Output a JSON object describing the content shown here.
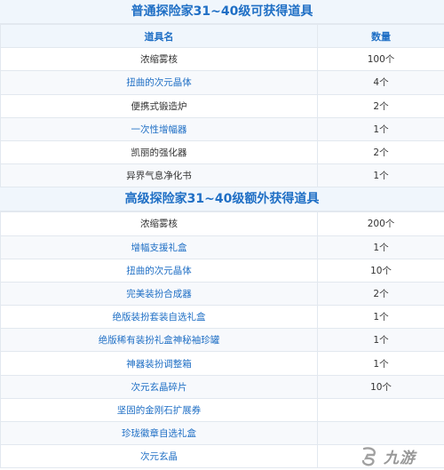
{
  "section1": {
    "title": "普通探险家31~40级可获得道具",
    "header": {
      "item": "道具名",
      "qty": "数量"
    },
    "rows": [
      {
        "name": "浓缩雾核",
        "qty": "100个",
        "link": false
      },
      {
        "name": "扭曲的次元晶体",
        "qty": "4个",
        "link": true
      },
      {
        "name": "便携式锻造炉",
        "qty": "2个",
        "link": false
      },
      {
        "name": "一次性增幅器",
        "qty": "1个",
        "link": true
      },
      {
        "name": "凯丽的强化器",
        "qty": "2个",
        "link": false
      },
      {
        "name": "异界气息净化书",
        "qty": "1个",
        "link": false
      }
    ]
  },
  "section2": {
    "title": "高级探险家31~40级额外获得道具",
    "rows": [
      {
        "name": "浓缩雾核",
        "qty": "200个",
        "link": false
      },
      {
        "name": "增幅支援礼盒",
        "qty": "1个",
        "link": true
      },
      {
        "name": "扭曲的次元晶体",
        "qty": "10个",
        "link": true
      },
      {
        "name": "完美装扮合成器",
        "qty": "2个",
        "link": true
      },
      {
        "name": "绝版装扮套装自选礼盒",
        "qty": "1个",
        "link": true
      },
      {
        "name": "绝版稀有装扮礼盒神秘袖珍罐",
        "qty": "1个",
        "link": true
      },
      {
        "name": "神器装扮调整箱",
        "qty": "1个",
        "link": true
      },
      {
        "name": "次元玄晶碎片",
        "qty": "10个",
        "link": true
      },
      {
        "name": "坚固的金刚石扩展券",
        "qty": "",
        "link": true
      },
      {
        "name": "珍珑徽章自选礼盒",
        "qty": "",
        "link": true
      },
      {
        "name": "次元玄晶",
        "qty": "",
        "link": true
      }
    ]
  },
  "watermark": {
    "text": "九游",
    "icon": "jiuyou-logo-icon"
  }
}
